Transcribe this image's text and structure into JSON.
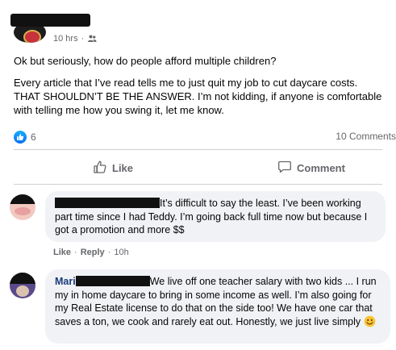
{
  "post": {
    "timestamp": "10 hrs",
    "separator": "·",
    "paragraph1": "Ok but seriously, how do people afford multiple children?",
    "paragraph2": "Every article that I’ve read tells me to just quit my job to cut daycare costs. THAT SHOULDN’T BE THE ANSWER. I’m not kidding, if anyone is comfortable with telling me how you swing it, let me know.",
    "reaction_count": "6",
    "comments_count": "10 Comments"
  },
  "actions": {
    "like_label": "Like",
    "comment_label": "Comment"
  },
  "comments": [
    {
      "text": "It’s difficult to say the least. I’ve been working part time since I had Teddy. I’m going back full time now but because I got a promotion and more $$",
      "like_label": "Like",
      "reply_label": "Reply",
      "time": "10h",
      "separator": "·"
    },
    {
      "name_partial": "Mari",
      "text": "We live off one teacher salary with two kids ... I run my in home daycare to bring in some income as well. I’m also going for my Real Estate license to do that on the side too! We have one car that saves a ton, we cook and rarely eat out. Honestly, we just live simply"
    }
  ],
  "colors": {
    "facebook_blue": "#1877f2",
    "secondary_text": "#65676b",
    "bubble_bg": "#f0f2f5"
  },
  "icons": [
    "audience-friends-icon",
    "like-reaction-icon",
    "thumbs-up-icon",
    "comment-icon",
    "smile-emoji-icon"
  ]
}
